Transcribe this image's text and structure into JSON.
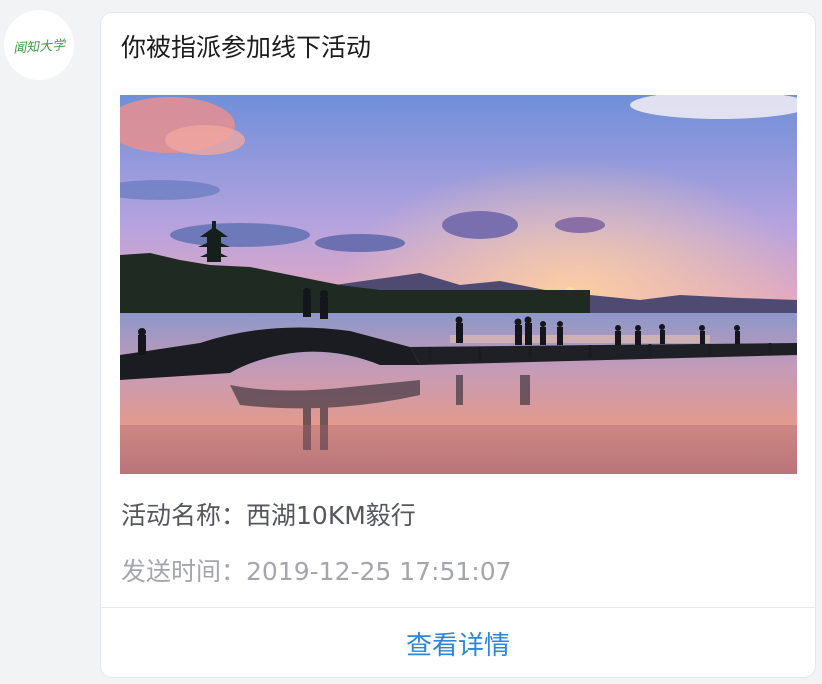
{
  "sender": {
    "avatar_text": "闻知大学"
  },
  "message": {
    "title": "你被指派参加线下活动",
    "activity_name_label": "活动名称：",
    "activity_name": "西湖10KM毅行",
    "send_time_label": "发送时间：",
    "send_time": "2019-12-25 17:51:07",
    "detail_button": "查看详情"
  },
  "colors": {
    "accent": "#2f86d8",
    "avatar_text": "#3f9a4a"
  }
}
